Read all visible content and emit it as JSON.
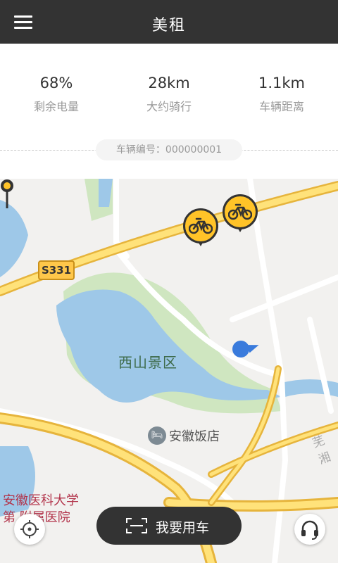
{
  "header": {
    "title": "美租",
    "menu_icon": "menu-icon"
  },
  "stats": [
    {
      "value": "68%",
      "label": "剩余电量"
    },
    {
      "value": "28km",
      "label": "大约骑行"
    },
    {
      "value": "1.1km",
      "label": "车辆距离"
    }
  ],
  "vehicle": {
    "id_text": "车辆编号：000000001"
  },
  "map": {
    "road_sign": "S331",
    "scenic_label": "西山景区",
    "hotel_label": "安徽饭店",
    "hotel_icon_glyph": "🛏",
    "university_label_line1": "安徽医科大学",
    "university_label_line2": "第 附属医院",
    "road_label_partial": "芜湘",
    "colors": {
      "water": "#9ec8e8",
      "park": "#cfe6c0",
      "road_major": "#f4c547",
      "road_minor": "#ffffff"
    }
  },
  "actions": {
    "rent_button": "我要用车",
    "locate_icon": "crosshair-icon",
    "support_icon": "headset-icon"
  },
  "colors": {
    "accent": "#ffc328",
    "dark": "#333333"
  }
}
